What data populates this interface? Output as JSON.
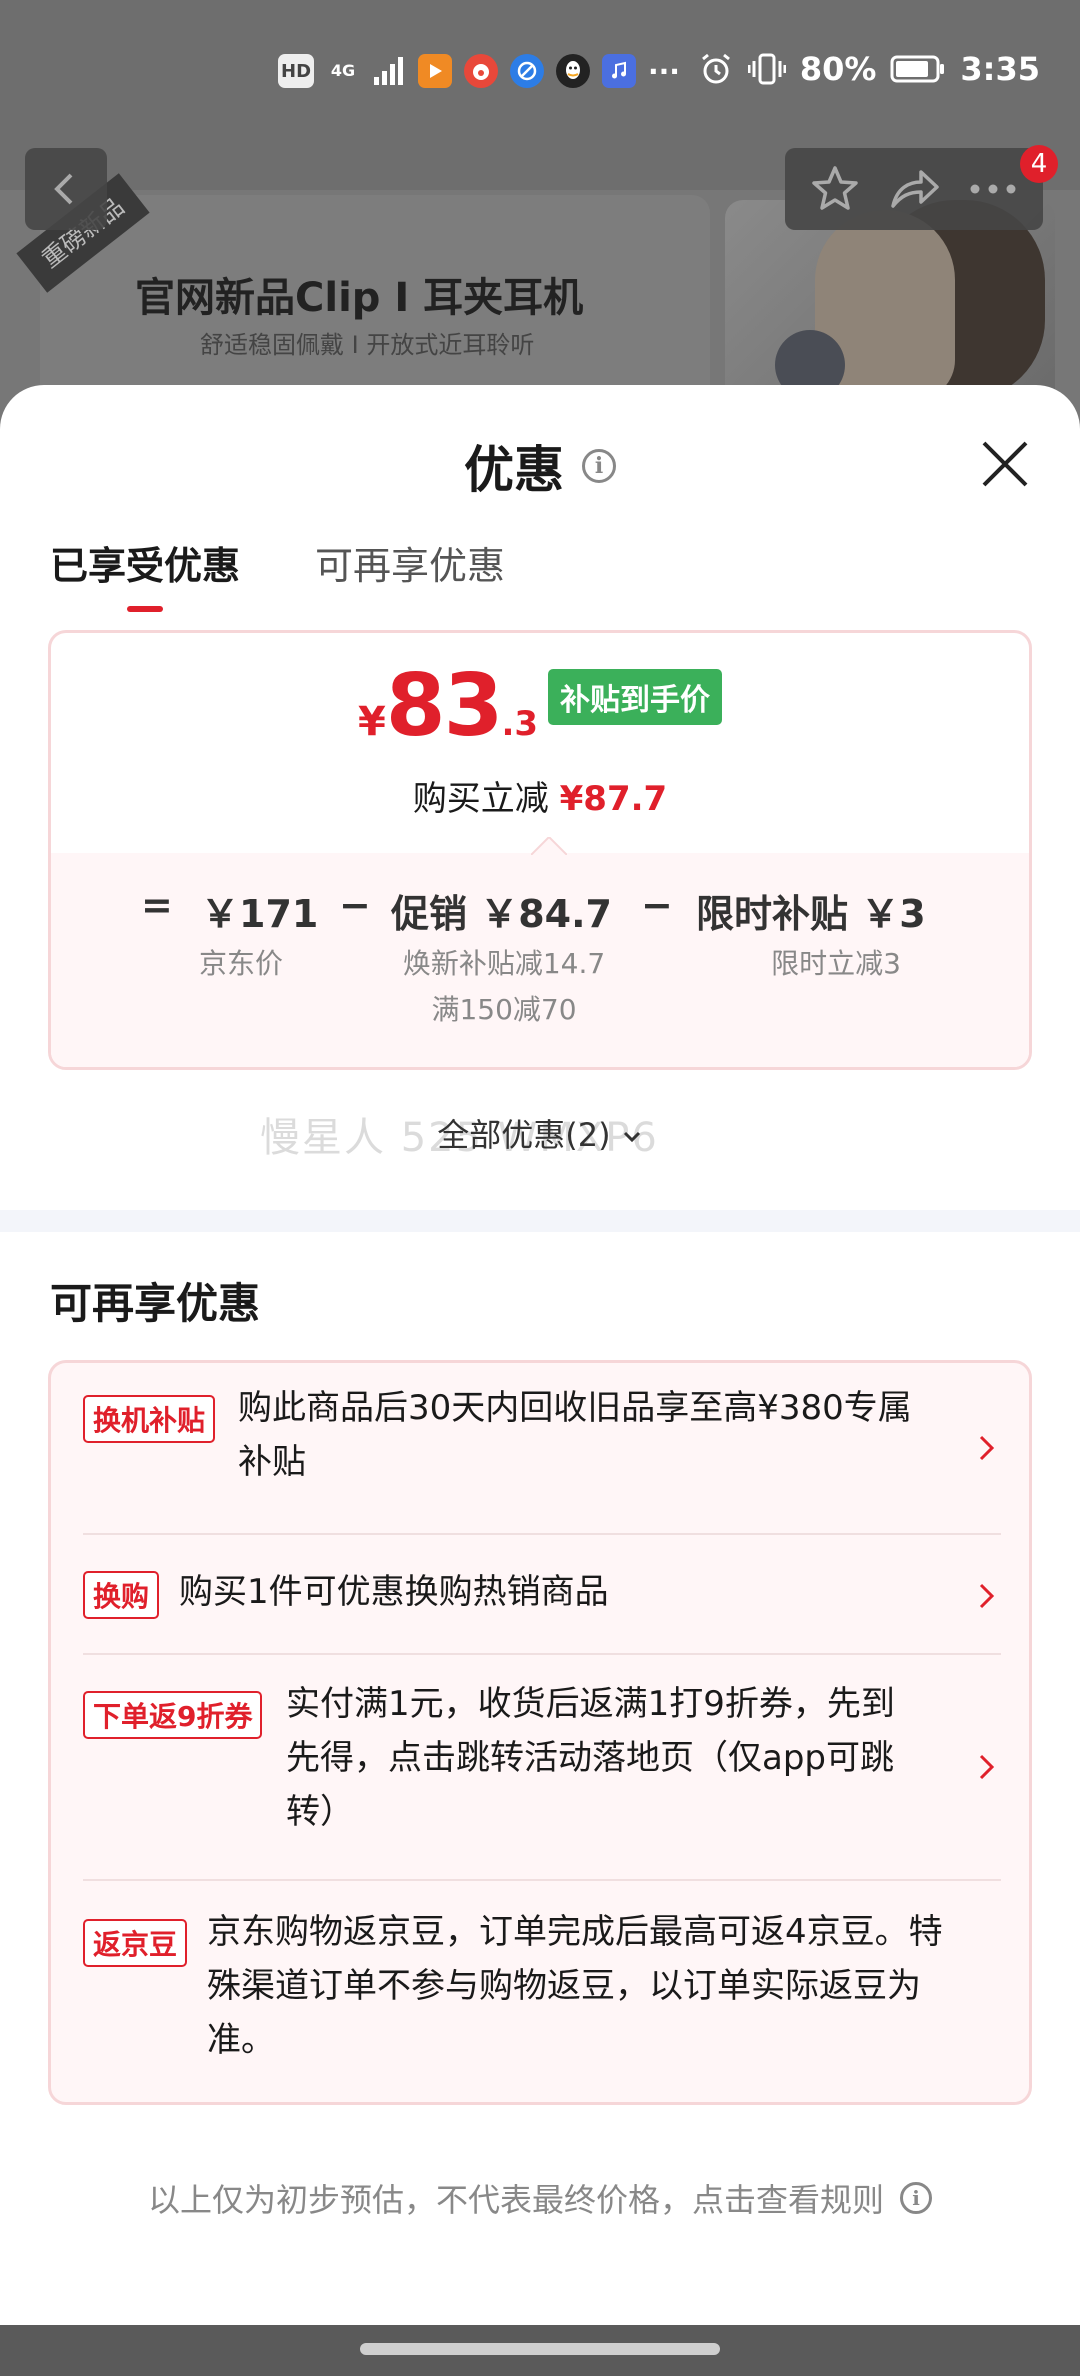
{
  "status_bar": {
    "hd": "HD",
    "network": "4G",
    "more": "···",
    "battery": "80%",
    "time": "3:35"
  },
  "background": {
    "ribbon": "重磅新品",
    "title": "官网新品Clip I 耳夹耳机",
    "subtitle": "舒适稳固佩戴 I 开放式近耳聆听",
    "badge": "4"
  },
  "sheet": {
    "title": "优惠",
    "tabs": [
      {
        "label": "已享受优惠",
        "active": true
      },
      {
        "label": "可再享优惠",
        "active": false
      }
    ],
    "price": {
      "currency": "¥",
      "integer": "83",
      "decimal": ".3",
      "tag": "补贴到手价",
      "reduce_label": "购买立减",
      "reduce_value": "¥87.7"
    },
    "formula": {
      "eq": "=",
      "jd_price": "￥171",
      "jd_price_label": "京东价",
      "minus1": "−",
      "promo": "促销 ￥84.7",
      "promo_detail_1": "焕新补贴减14.7",
      "promo_detail_2": "满150减70",
      "minus2": "−",
      "limited": "限时补贴 ￥3",
      "limited_detail": "限时立减3"
    },
    "all_offers": "全部优惠(2)",
    "watermark": "慢星人 525 WMXP6",
    "section_title": "可再享优惠",
    "offers": [
      {
        "tag": "换机补贴",
        "text": "购此商品后30天内回收旧品享至高¥380专属补贴",
        "line1": "购此商品后30天内回收旧品享至高¥380专属",
        "line2": "补贴",
        "line3": ""
      },
      {
        "tag": "换购",
        "text": "购买1件可优惠换购热销商品",
        "line1": "购买1件可优惠换购热销商品",
        "line2": "",
        "line3": ""
      },
      {
        "tag": "下单返9折券",
        "text": "实付满1元，收货后返满1打9折券，先到先得，点击跳转活动落地页（仅app可跳转）",
        "line1": "实付满1元，收货后返满1打9折券，先到",
        "line2": "先得，点击跳转活动落地页（仅app可跳",
        "line3": "转）"
      },
      {
        "tag": "返京豆",
        "text": "京东购物返京豆，订单完成后最高可返4京豆。特殊渠道订单不参与购物返豆，以订单实际返豆为准。",
        "line1": "京东购物返京豆，订单完成后最高可返4京豆。特",
        "line2": "殊渠道订单不参与购物返豆，以订单实际返豆为",
        "line3": "准。"
      }
    ],
    "footer_note": "以上仅为初步预估，不代表最终价格，点击查看规则"
  },
  "colors": {
    "accent_red": "#e0202b",
    "subsidy_green": "#3bb05a",
    "card_border": "#f6d6d8",
    "card_bg": "#fff6f7"
  }
}
